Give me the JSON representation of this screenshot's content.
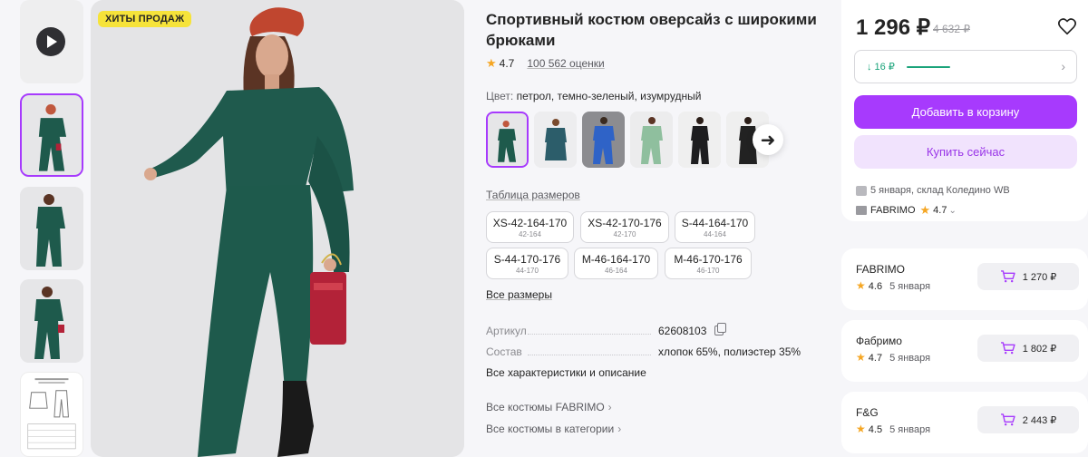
{
  "colors": {
    "accent": "#a73afd",
    "accent_light": "#f1e3fd",
    "green": "#1aa37a",
    "star": "#f5a623",
    "badge": "#f6e33a"
  },
  "gallery": {
    "badge": "ХИТЫ ПРОДАЖ",
    "thumbnails": [
      "video-play-icon",
      "photo-1",
      "photo-2",
      "photo-3",
      "size-chart"
    ]
  },
  "product": {
    "title": "Спортивный костюм оверсайз с широкими брюками",
    "rating": "4.7",
    "reviews": "100 562 оценки",
    "color_label": "Цвет:",
    "color_value": "петрол, темно-зеленый, изумрудный",
    "size_table_link": "Таблица размеров",
    "sizes": [
      {
        "main": "XS-42-164-170",
        "sub": "42-164"
      },
      {
        "main": "XS-42-170-176",
        "sub": "42-170"
      },
      {
        "main": "S-44-164-170",
        "sub": "44-164"
      },
      {
        "main": "S-44-170-176",
        "sub": "44-170"
      },
      {
        "main": "M-46-164-170",
        "sub": "46-164"
      },
      {
        "main": "M-46-170-176",
        "sub": "46-170"
      }
    ],
    "all_sizes": "Все размеры",
    "specs": [
      {
        "key": "Артикул",
        "value": "62608103"
      },
      {
        "key": "Состав",
        "value": "хлопок 65%, полиэстер 35%"
      }
    ],
    "all_characteristics": "Все характеристики и описание",
    "links": [
      "Все костюмы FABRIMO",
      "Все костюмы в категории"
    ]
  },
  "buy_panel": {
    "price": "1 296 ₽",
    "old_price": "4 632 ₽",
    "price_drop": "↓ 16 ₽",
    "add_to_cart": "Добавить в корзину",
    "buy_now": "Купить сейчас",
    "delivery": "5 января, склад Коледино WB",
    "seller": "FABRIMO",
    "seller_rating": "4.7"
  },
  "offers": [
    {
      "seller": "FABRIMO",
      "rating": "4.6",
      "date": "5 января",
      "price": "1 270 ₽"
    },
    {
      "seller": "Фабримо",
      "rating": "4.7",
      "date": "5 января",
      "price": "1 802 ₽"
    },
    {
      "seller": "F&G",
      "rating": "4.5",
      "date": "5 января",
      "price": "2 443 ₽"
    }
  ]
}
